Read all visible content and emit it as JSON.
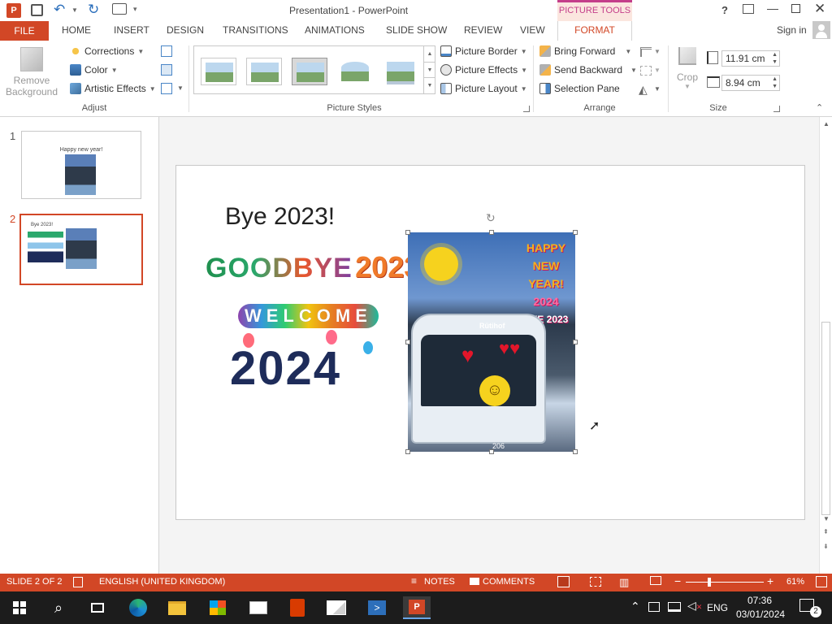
{
  "titlebar": {
    "title": "Presentation1 - PowerPoint",
    "contextual_tab": "PICTURE TOOLS",
    "help": "?",
    "accent": "#d24726"
  },
  "tabs": {
    "file": "FILE",
    "items": [
      "HOME",
      "INSERT",
      "DESIGN",
      "TRANSITIONS",
      "ANIMATIONS",
      "SLIDE SHOW",
      "REVIEW",
      "VIEW"
    ],
    "format": "FORMAT",
    "sign_in": "Sign in"
  },
  "ribbon": {
    "adjust": {
      "remove_background": [
        "Remove",
        "Background"
      ],
      "corrections": "Corrections",
      "color": "Color",
      "artistic_effects": "Artistic Effects",
      "label": "Adjust"
    },
    "picture_styles": {
      "border": "Picture Border",
      "effects": "Picture Effects",
      "layout": "Picture Layout",
      "label": "Picture Styles"
    },
    "arrange": {
      "bring_forward": "Bring Forward",
      "send_backward": "Send Backward",
      "selection_pane": "Selection Pane",
      "label": "Arrange"
    },
    "size": {
      "crop": "Crop",
      "height": "11.91 cm",
      "width": "8.94 cm",
      "label": "Size"
    }
  },
  "thumbnails": [
    {
      "num": "1",
      "title": "Happy new year!"
    },
    {
      "num": "2",
      "title": "Bye 2023!"
    }
  ],
  "slide": {
    "title": "Bye 2023!",
    "goodbye_text": "GOODBYE",
    "goodbye_year": "2023",
    "welcome_text": "WELCOME",
    "welcome_year": "2024",
    "photo_overlay": [
      "HAPPY",
      "NEW",
      "YEAR!",
      "2024",
      "BYE 2023"
    ],
    "bus_sign": "Rütihof",
    "bus_number": "206"
  },
  "status": {
    "slide": "SLIDE 2 OF 2",
    "language": "ENGLISH (UNITED KINGDOM)",
    "notes": "NOTES",
    "comments": "COMMENTS",
    "zoom": "61%",
    "zoom_fraction": 0.61
  },
  "taskbar": {
    "language": "ENG",
    "time": "07:36",
    "date": "03/01/2024",
    "notifications": "2"
  }
}
